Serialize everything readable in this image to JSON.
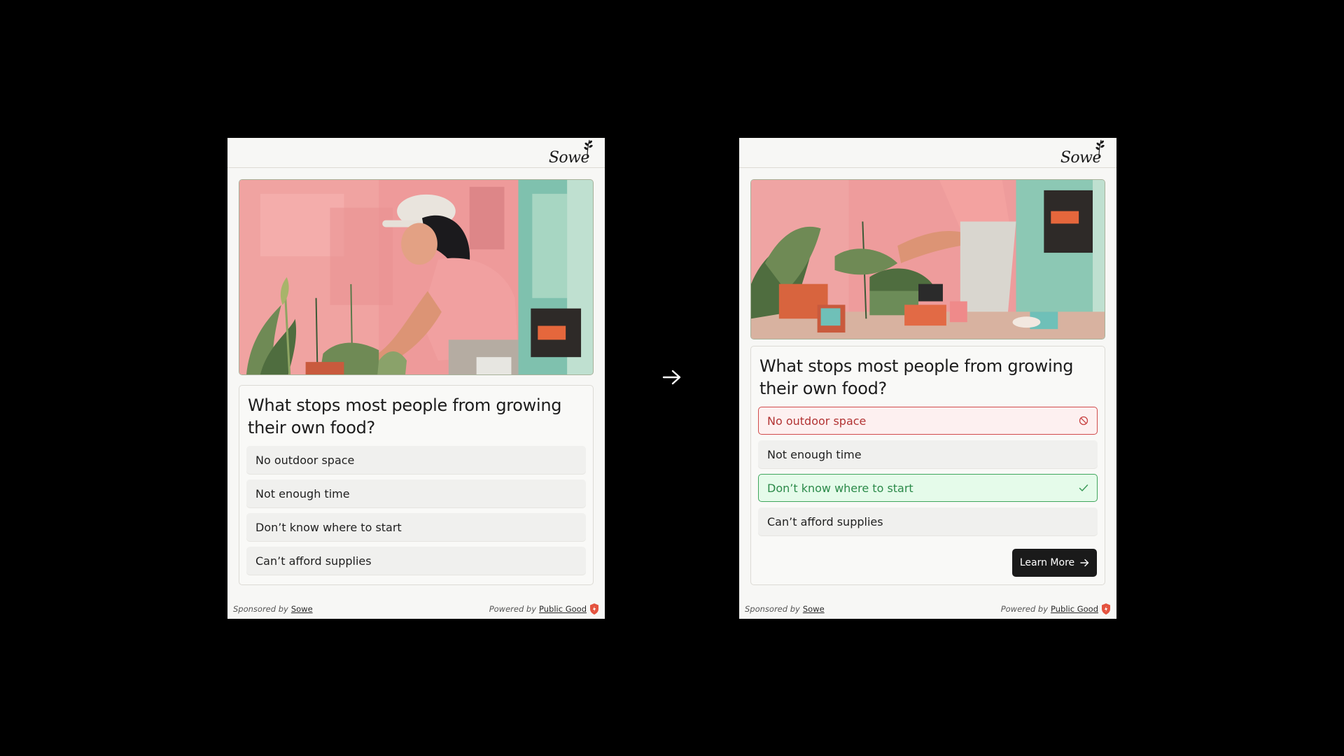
{
  "brand": {
    "logo_text": "Sowe"
  },
  "quiz": {
    "question": "What stops most people from growing their own food?",
    "options": [
      {
        "label": "No outdoor space"
      },
      {
        "label": "Not enough time"
      },
      {
        "label": "Don’t know where to start"
      },
      {
        "label": "Can’t afford supplies"
      }
    ],
    "result_states": {
      "No outdoor space": "incorrect",
      "Don’t know where to start": "correct"
    },
    "learn_more_label": "Learn More"
  },
  "footer": {
    "sponsored_text": "Sponsored by",
    "sponsor_link": "Sowe",
    "powered_text": "Powered by",
    "powered_link": "Public Good"
  },
  "icons": [
    "sprig-icon",
    "block-icon",
    "check-icon",
    "arrow-right-icon",
    "shield-icon"
  ],
  "colors": {
    "background": "#000000",
    "widget_bg": "#f7f7f5",
    "wrong_border": "#d14b4b",
    "wrong_bg": "#fdf0f0",
    "correct_border": "#3fa65c",
    "correct_bg": "#e5fbea",
    "button_bg": "#1a1a1a",
    "shield": "#e4533f"
  }
}
